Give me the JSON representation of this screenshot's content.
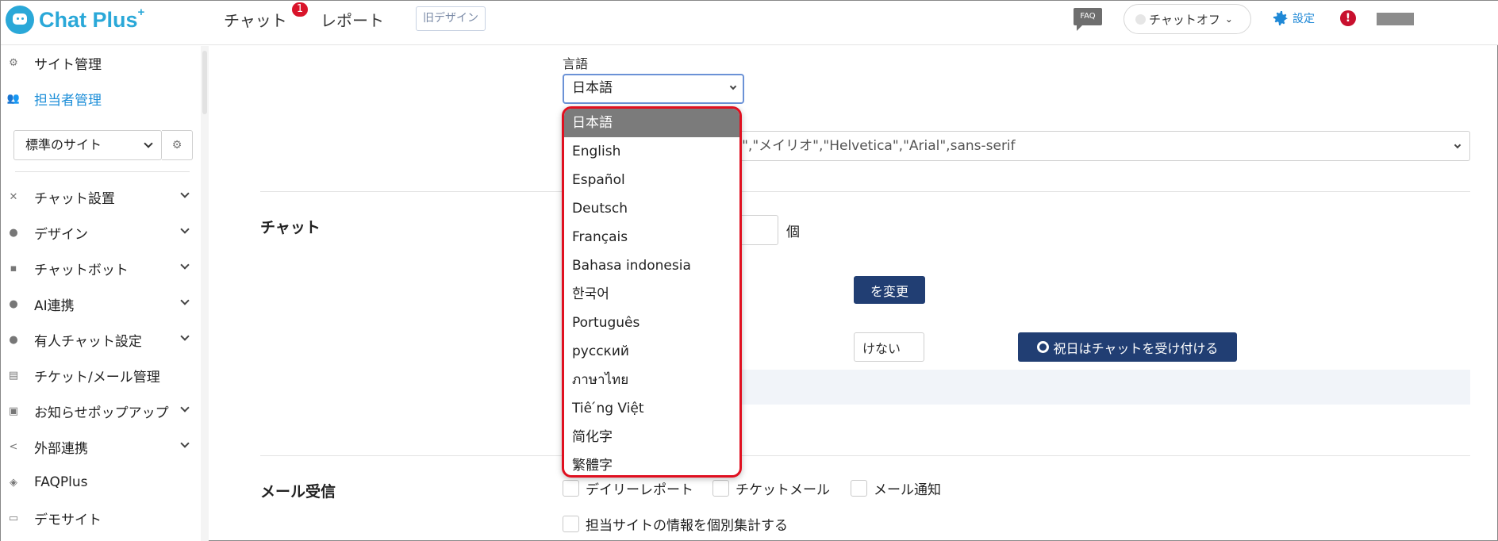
{
  "header": {
    "logo_text": "Chat Plus",
    "logo_sup": "+",
    "nav": [
      {
        "label": "チャット",
        "badge": "1"
      },
      {
        "label": "レポート"
      }
    ],
    "old_design_label": "旧デザイン",
    "faq_label": "FAQ",
    "chat_status_label": "チャットオフ",
    "settings_label": "設定",
    "alert_symbol": "!"
  },
  "sidebar": {
    "top_items": [
      {
        "label": "サイト管理",
        "icon": "gear-icon"
      },
      {
        "label": "担当者管理",
        "icon": "users-icon",
        "active": true
      }
    ],
    "site_select_value": "標準のサイト",
    "items": [
      {
        "label": "チャット設置",
        "icon": "tools-icon",
        "chevron": true
      },
      {
        "label": "デザイン",
        "icon": "palette-icon",
        "chevron": true
      },
      {
        "label": "チャットボット",
        "icon": "chat-bubble-icon",
        "chevron": true
      },
      {
        "label": "AI連携",
        "icon": "bulb-icon",
        "chevron": true
      },
      {
        "label": "有人チャット設定",
        "icon": "person-chat-icon",
        "chevron": true
      },
      {
        "label": "チケット/メール管理",
        "icon": "list-icon",
        "chevron": false
      },
      {
        "label": "お知らせポップアップ",
        "icon": "popup-icon",
        "chevron": true
      },
      {
        "label": "外部連携",
        "icon": "share-icon",
        "chevron": true
      },
      {
        "label": "FAQPlus",
        "icon": "shield-icon",
        "chevron": false
      },
      {
        "label": "デモサイト",
        "icon": "monitor-icon",
        "chevron": false
      }
    ]
  },
  "main": {
    "language_label": "言語",
    "language_value": "日本語",
    "font_value": "oN\",\"メイリオ\",\"Helvetica\",\"Arial\",sans-serif",
    "chat_section_title": "チャット",
    "count_unit": "個",
    "change_button_partial": "を変更",
    "holiday_no_partial": "けない",
    "holiday_yes_label": "祝日はチャットを受け付ける",
    "mail_section_title": "メール受信",
    "mail_checks": [
      "デイリーレポート",
      "チケットメール",
      "メール通知"
    ],
    "aggregate_check": "担当サイトの情報を個別集計する"
  },
  "dropdown": {
    "selected_index": 0,
    "options": [
      "日本語",
      "English",
      "Español",
      "Deutsch",
      "Français",
      "Bahasa indonesia",
      "한국어",
      "Português",
      "русский",
      "ภาษาไทย",
      "Tiê ́ng Việt",
      "简化字",
      "繁體字"
    ]
  },
  "colors": {
    "brand": "#2aa8d8",
    "navy": "#213e73",
    "highlight_border": "#e01020",
    "active_link": "#1c8ed8"
  }
}
